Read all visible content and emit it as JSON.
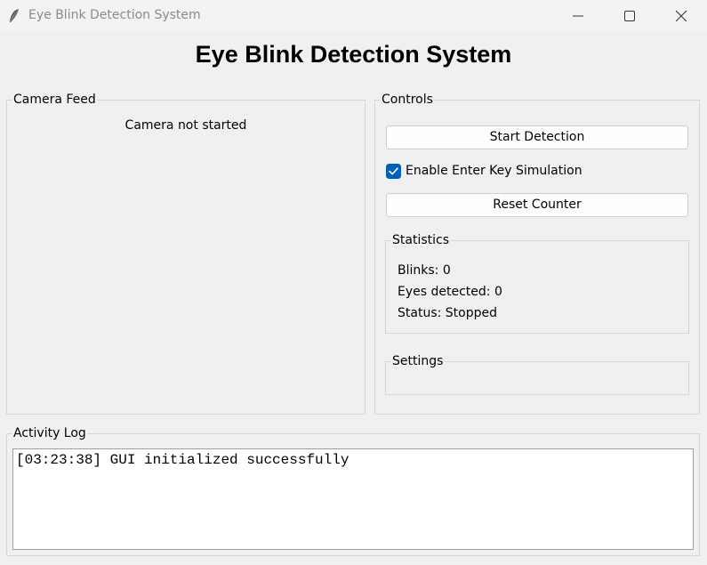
{
  "window": {
    "title": "Eye Blink Detection System",
    "icon": "feather-icon"
  },
  "heading": "Eye Blink Detection System",
  "camera": {
    "label": "Camera Feed",
    "status": "Camera not started"
  },
  "controls": {
    "label": "Controls",
    "start_button": "Start Detection",
    "enter_key_checkbox": {
      "label": "Enable Enter Key Simulation",
      "checked": true
    },
    "reset_button": "Reset Counter"
  },
  "statistics": {
    "label": "Statistics",
    "blinks": "Blinks: 0",
    "eyes": "Eyes detected: 0",
    "status": "Status: Stopped"
  },
  "settings": {
    "label": "Settings"
  },
  "log": {
    "label": "Activity Log",
    "content": "[03:23:38] GUI initialized successfully"
  },
  "colors": {
    "accent": "#005fb8",
    "background": "#f0f0f0"
  }
}
